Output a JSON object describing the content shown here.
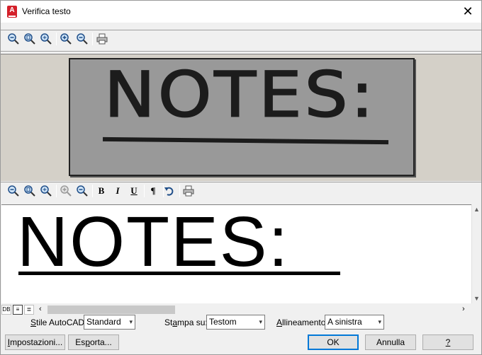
{
  "window": {
    "title": "Verifica testo",
    "app_icon_letter": "A",
    "close_glyph": "✕"
  },
  "image_toolbar": {
    "icons": [
      "zoom-out-icon",
      "zoom-fit-icon",
      "zoom-window-icon",
      "zoom-in-icon",
      "zoom-out-small-icon",
      "print-icon"
    ]
  },
  "text_toolbar": {
    "bold": "B",
    "italic": "I",
    "underline": "U",
    "paragraph": "¶"
  },
  "scanned_image": {
    "text": "NOTES:"
  },
  "edit": {
    "text": "NOTES: "
  },
  "view_buttons": [
    "DB",
    "≡",
    "≣"
  ],
  "style_row": {
    "style_label": "Stile AutoCAD:",
    "style_value": "Standard",
    "print_label": "Stampa su:",
    "print_value": "Testom",
    "align_label": "Allineamento:",
    "align_value": "A sinistra"
  },
  "buttons": {
    "settings": "Impostazioni...",
    "export": "Esporta...",
    "ok": "OK",
    "cancel": "Annulla",
    "help": "?"
  },
  "colors": {
    "title_icon": "#d4202a",
    "default_button_border": "#0078d7",
    "image_background": "#d4d0c8"
  }
}
